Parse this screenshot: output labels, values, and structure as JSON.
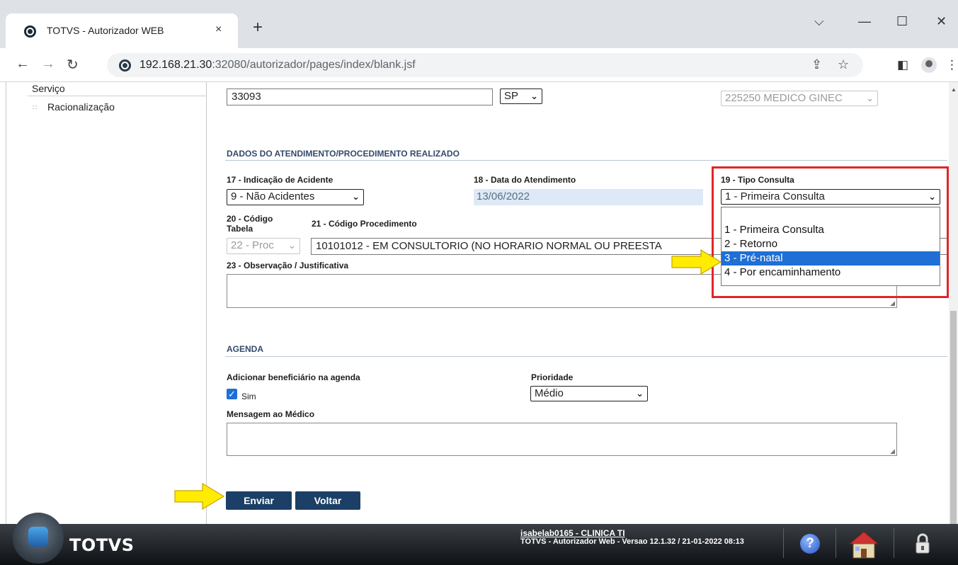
{
  "browser": {
    "tab_title": "TOTVS - Autorizador WEB",
    "tab_close": "×",
    "new_tab": "+",
    "url_host": "192.168.21.30",
    "url_rest": ":32080/autorizador/pages/index/blank.jsf",
    "icons": [
      "back-arrow-icon",
      "forward-arrow-icon",
      "reload-icon",
      "share-icon",
      "bookmark-star-icon",
      "side-panel-icon",
      "profile-icon",
      "menu-dots-icon"
    ]
  },
  "sidebar": {
    "items": [
      {
        "label": "Serviço"
      },
      {
        "label": "Racionalização"
      }
    ]
  },
  "form": {
    "conselho_value": "33093",
    "uf_value": "SP",
    "cbo_value": "225250 MEDICO GINEC",
    "section_atendimento": "DADOS DO ATENDIMENTO/PROCEDIMENTO REALIZADO",
    "lbl_acidente": "17 - Indicação de Acidente",
    "acidente_value": "9 - Não Acidentes",
    "lbl_data": "18 - Data do Atendimento",
    "data_value": "13/06/2022",
    "lbl_tipo": "19 - Tipo Consulta",
    "tipo_value": "1 - Primeira Consulta",
    "tipo_options": [
      "1 - Primeira Consulta",
      "2 - Retorno",
      "3 - Pré-natal",
      "4 - Por encaminhamento"
    ],
    "tipo_highlighted": "3 - Pré-natal",
    "lbl_codigo_tabela_1": "20 - Código",
    "lbl_codigo_tabela_2": "Tabela",
    "tabela_value": "22 - Proc",
    "lbl_procedimento": "21 - Código Procedimento",
    "procedimento_value": "10101012 - EM CONSULTORIO (NO HORARIO NORMAL OU PREESTA",
    "lbl_observacao": "23 - Observação / Justificativa",
    "section_agenda": "AGENDA",
    "lbl_adicionar": "Adicionar beneficiário na agenda",
    "sim_label": "Sim",
    "sim_checked": true,
    "lbl_prioridade": "Prioridade",
    "prioridade_value": "Médio",
    "lbl_mensagem": "Mensagem ao Médico",
    "btn_enviar": "Enviar",
    "btn_voltar": "Voltar"
  },
  "footer": {
    "logo": "TOTVS",
    "user": "isabelab0165 - CLINICA TI",
    "version": "TOTVS - Autorizador Web - Versao 12.1.32 / 21-01-2022 08:13",
    "icons": [
      "help-icon",
      "home-icon",
      "lock-icon"
    ]
  },
  "colors": {
    "accent_button": "#1b3f66",
    "highlight_red": "#e0262a",
    "selected_option": "#1e6fd6",
    "annotation_arrow": "#ffec00"
  }
}
